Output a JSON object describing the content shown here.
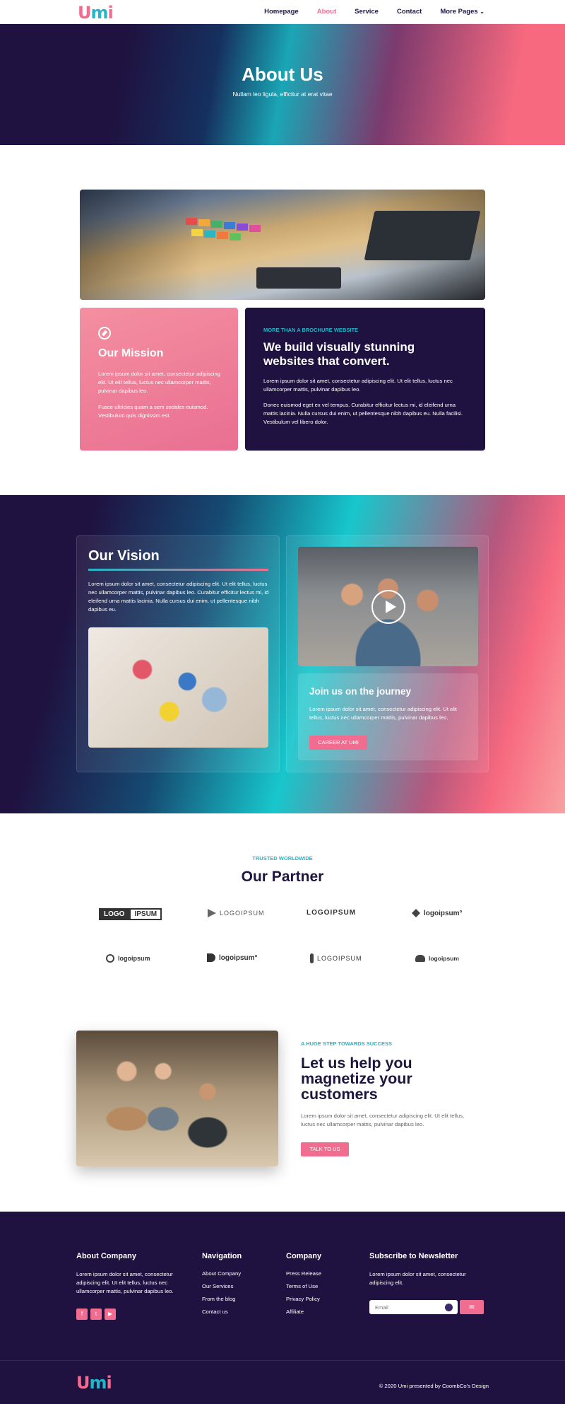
{
  "header": {
    "logo": {
      "u": "U",
      "m": "m",
      "i": "i"
    },
    "nav": [
      {
        "label": "Homepage",
        "active": false
      },
      {
        "label": "About",
        "active": true
      },
      {
        "label": "Service",
        "active": false
      },
      {
        "label": "Contact",
        "active": false
      },
      {
        "label": "More Pages",
        "active": false
      }
    ]
  },
  "hero": {
    "title": "About Us",
    "subtitle": "Nullam leo ligula, efficitur at erat vitae"
  },
  "mission": {
    "title": "Our Mission",
    "p1": "Lorem ipsum dolor sit amet, consectetur adipiscing elit. Ut elit tellus, luctus nec ullamcorper mattis, pulvinar dapibus leo.",
    "p2": "Fusce ultricies quam a sem sodales euismod. Vestibulum quis dignissim est."
  },
  "brochure": {
    "kicker": "MORE THAN A BROCHURE WEBSITE",
    "title": "We build visually stunning websites that convert.",
    "p1": "Lorem ipsum dolor sit amet, consectetur adipiscing elit. Ut elit tellus, luctus nec ullamcorper mattis, pulvinar dapibus leo.",
    "p2": "Donec euismod eget ex vel tempus. Curabitur efficitur lectus mi, id eleifend urna mattis lacinia. Nulla cursus dui enim, ut pellentesque nibh dapibus eu. Nulla facilisi. Vestibulum vel libero dolor."
  },
  "vision": {
    "title": "Our Vision",
    "text": "Lorem ipsum dolor sit amet, consectetur adipiscing elit. Ut elit tellus, luctus nec ullamcorper mattis, pulvinar dapibus leo. Curabitur efficitur lectus mi, id eleifend urna mattis lacinia. Nulla cursus dui enim, ut pellentesque nibh dapibus eu."
  },
  "journey": {
    "title": "Join us on the journey",
    "text": "Lorem ipsum dolor sit amet, consectetur adipiscing elit. Ut elit tellus, luctus nec ullamcorper mattis, pulvinar dapibus leo.",
    "button": "CAREER AT UMI"
  },
  "partners": {
    "kicker": "TRUSTED WORLDWIDE",
    "title": "Our Partner",
    "logos": [
      {
        "a": "LOGO",
        "b": "IPSUM"
      },
      {
        "text": "LOGOIPSUM"
      },
      {
        "text": "LOGOIPSUM"
      },
      {
        "text": "logoipsum°"
      },
      {
        "text": "logoipsum"
      },
      {
        "text": "logoipsum°"
      },
      {
        "text": "LOGOIPSUM"
      },
      {
        "text": "logoipsum"
      }
    ]
  },
  "help": {
    "kicker": "A HUGE STEP TOWARDS SUCCESS",
    "title": "Let us help you magnetize your customers",
    "text": "Lorem ipsum dolor sit amet, consectetur adipiscing elit. Ut elit tellus, luctus nec ullamcorper mattis, pulvinar dapibus leo.",
    "button": "TALK TO US"
  },
  "footer": {
    "about": {
      "title": "About Company",
      "text": "Lorem ipsum dolor sit amet, consectetur adipiscing elit. Ut elit tellus, luctus nec ullamcorper mattis, pulvinar dapibus leo."
    },
    "navigation": {
      "title": "Navigation",
      "links": [
        "About Company",
        "Our Services",
        "From the blog",
        "Contact us"
      ]
    },
    "company": {
      "title": "Company",
      "links": [
        "Press Release",
        "Terms of Use",
        "Privacy Policy",
        "Affiliate"
      ]
    },
    "newsletter": {
      "title": "Subscribe to Newsletter",
      "text": "Lorem ipsum dolor sit amet, consectetur adipiscing elit.",
      "placeholder": "Email"
    },
    "copyright": "© 2020 Umi presented by CoombCo's Design"
  },
  "colors": {
    "accent": "#f06d8f",
    "teal": "#1fb7c9",
    "navy": "#1f1240"
  }
}
